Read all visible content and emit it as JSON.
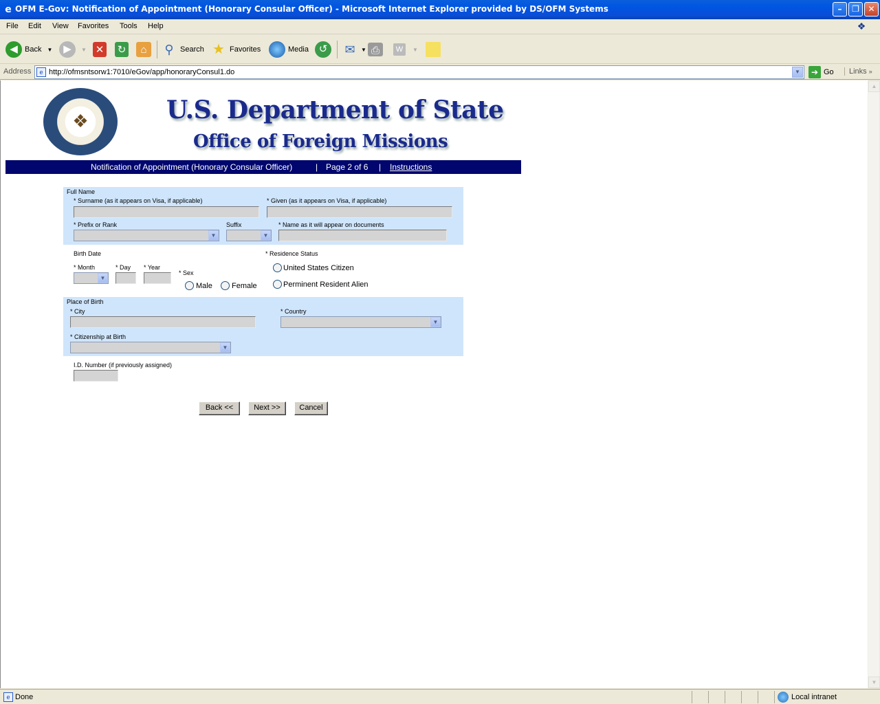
{
  "window": {
    "title": "OFM E-Gov: Notification of Appointment (Honorary Consular Officer) - Microsoft Internet Explorer provided by DS/OFM Systems"
  },
  "menu": {
    "items": [
      "File",
      "Edit",
      "View",
      "Favorites",
      "Tools",
      "Help"
    ]
  },
  "toolbar": {
    "back_label": "Back",
    "search_label": "Search",
    "favorites_label": "Favorites",
    "media_label": "Media"
  },
  "address": {
    "label": "Address",
    "url": "http://ofmsntsorw1:7010/eGov/app/honoraryConsul1.do",
    "go_label": "Go",
    "links_label": "Links"
  },
  "header": {
    "title1": "U.S. Department of State",
    "title2": "Office of Foreign Missions",
    "nav_title": "Notification of Appointment (Honorary Consular Officer)",
    "separator": "|",
    "page_indicator": "Page 2 of 6",
    "instructions_link": "Instructions"
  },
  "form": {
    "full_name_section": "Full Name",
    "surname_label": "* Surname (as it appears on Visa, if applicable)",
    "given_label": "* Given (as it appears on Visa, if applicable)",
    "prefix_label": "* Prefix or Rank",
    "suffix_label": "Suffix",
    "doc_name_label": "* Name as it will appear on documents",
    "birth_date_section": "Birth Date",
    "month_label": "* Month",
    "day_label": "* Day",
    "year_label": "* Year",
    "sex_label": "* Sex",
    "male_label": "Male",
    "female_label": "Female",
    "residence_label": "* Residence Status",
    "us_citizen_label": "United States Citizen",
    "resident_alien_label": "Perminent Resident Alien",
    "place_of_birth_section": "Place of Birth",
    "city_label": "* City",
    "country_label": "* Country",
    "citizenship_label": "* Citizenship at Birth",
    "id_number_label": "I.D. Number (if previously assigned)"
  },
  "buttons": {
    "back": "Back <<",
    "next": "Next >>",
    "cancel": "Cancel"
  },
  "status": {
    "text": "Done",
    "zone": "Local intranet"
  }
}
